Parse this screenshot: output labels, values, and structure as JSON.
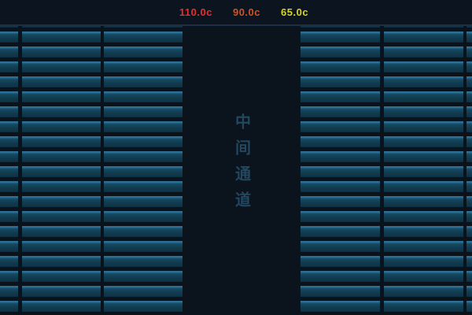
{
  "legend": {
    "items": [
      {
        "label": "110.0c",
        "color": "#e23030"
      },
      {
        "label": "90.0c",
        "color": "#d45122"
      },
      {
        "label": "65.0c",
        "color": "#d4d42c"
      }
    ]
  },
  "channel": {
    "label": "中间通道",
    "color": "#22475f"
  },
  "colors": {
    "background": "#0a121c",
    "header_background": "#0c1420",
    "bar_body": "#113a4e",
    "bar_highlight": "#2e7095",
    "channel_background": "#0b131d"
  }
}
